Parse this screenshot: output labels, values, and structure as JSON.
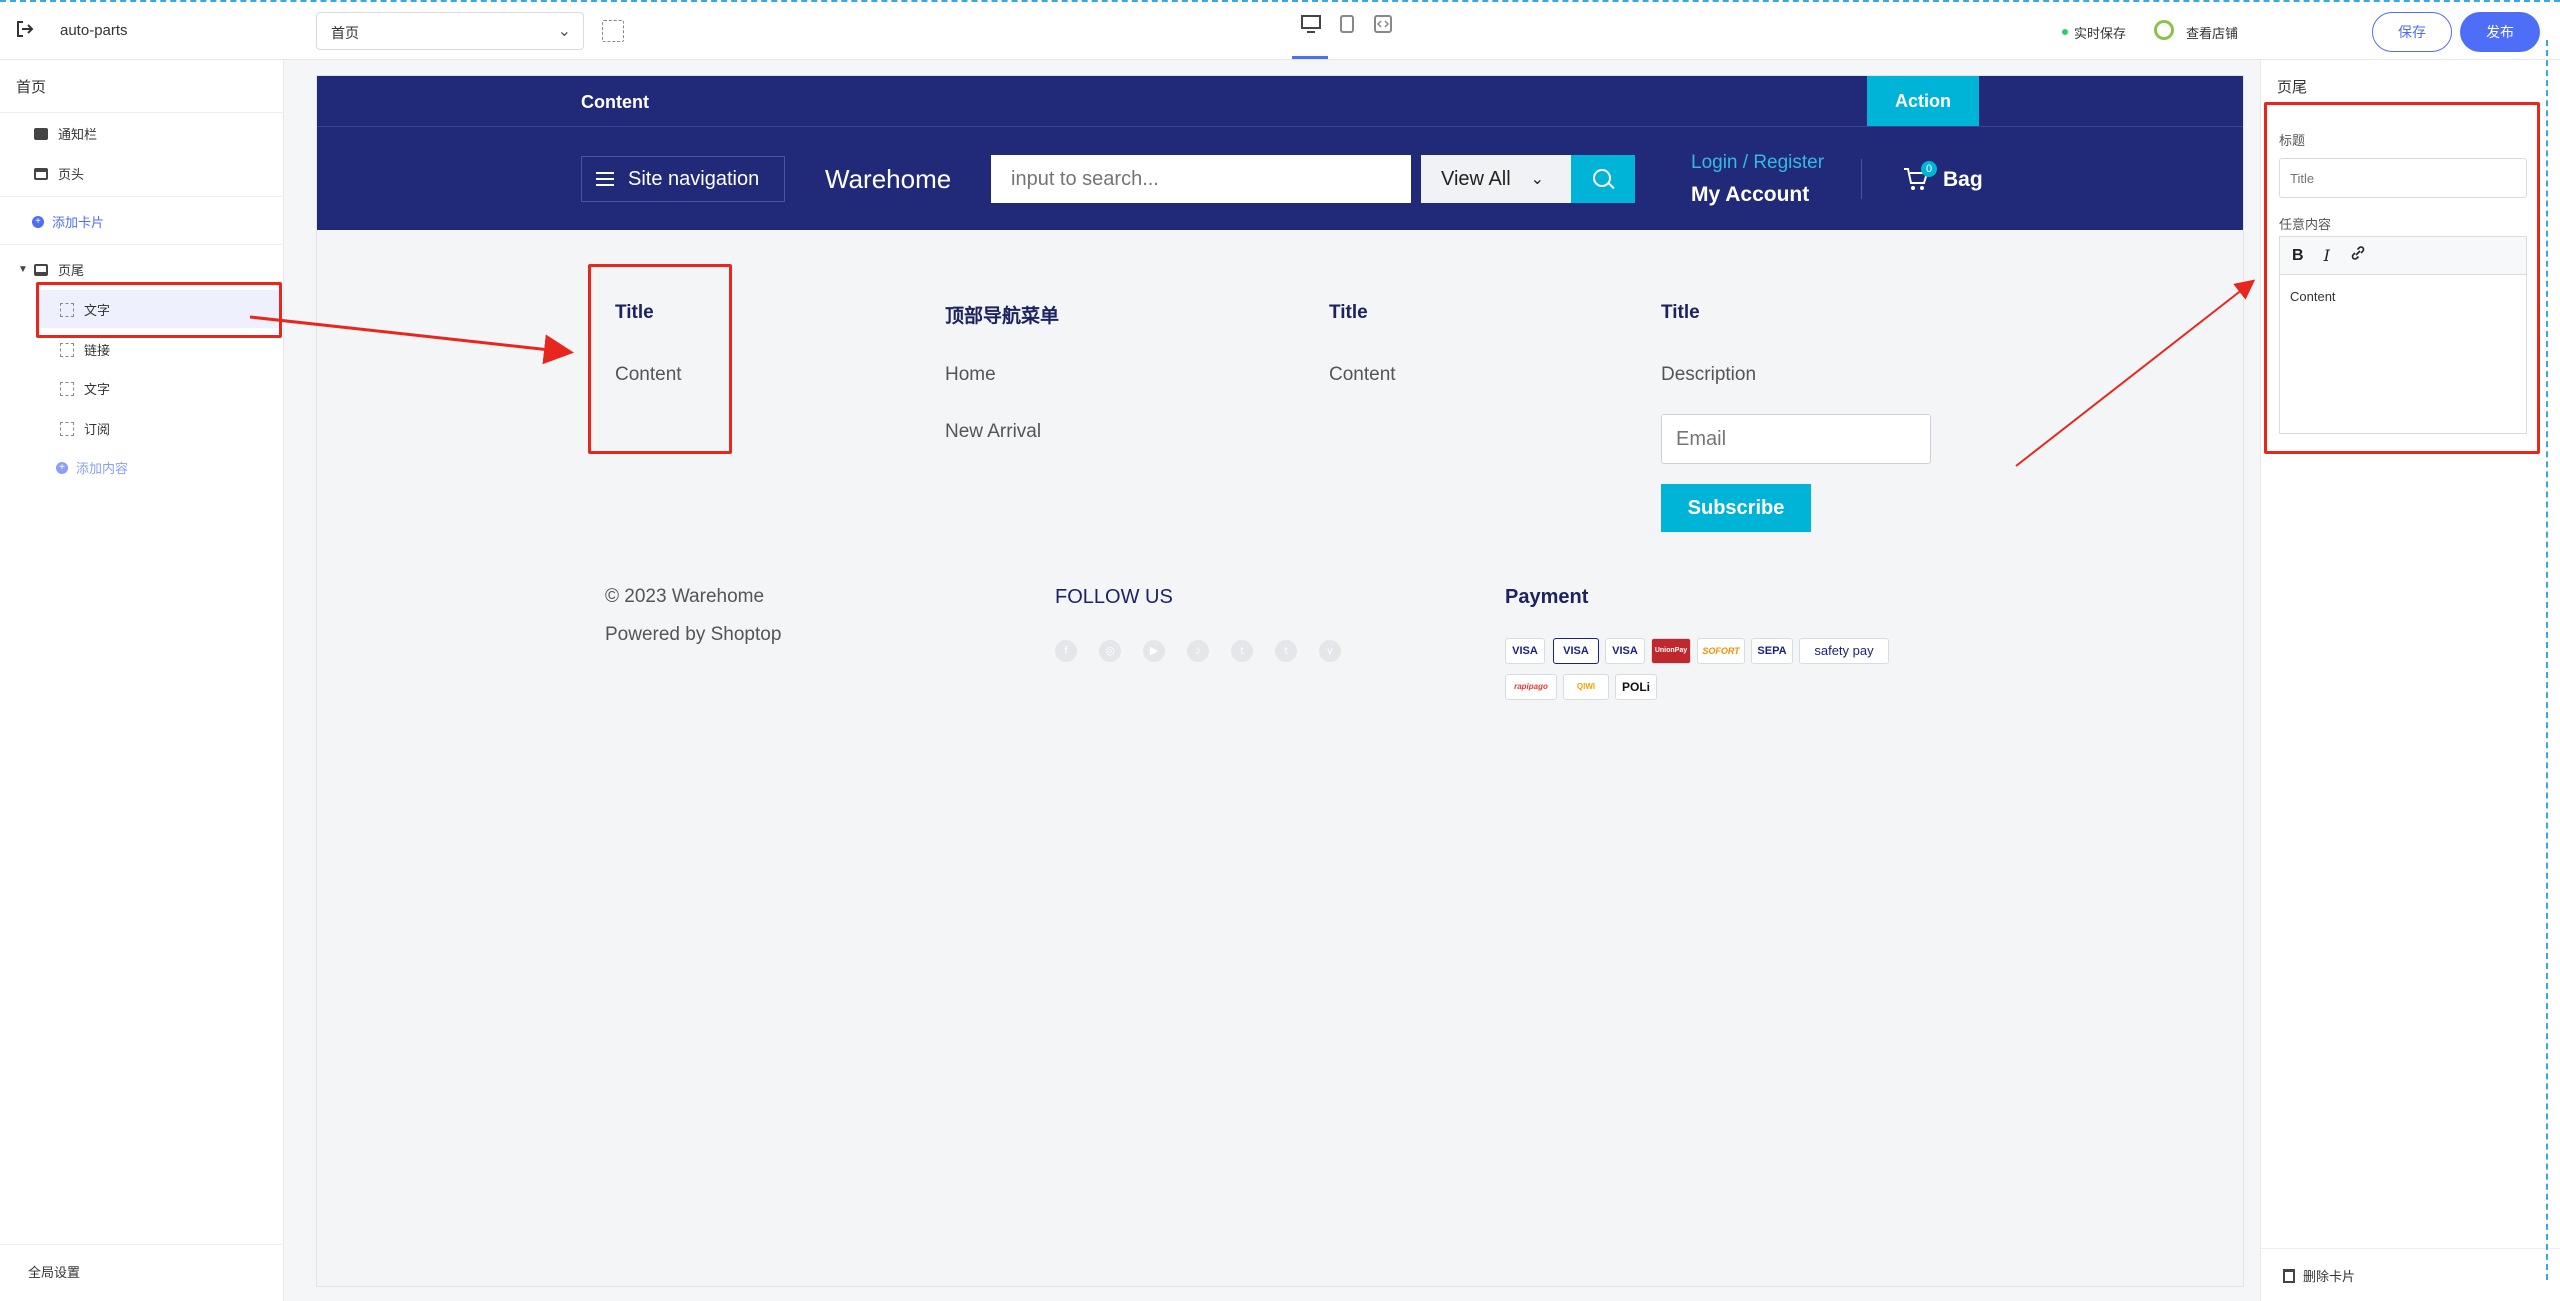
{
  "topbar": {
    "store_name": "auto-parts",
    "page_select": "首页",
    "autosave": "实时保存",
    "view_store": "查看店铺",
    "save": "保存",
    "publish": "发布"
  },
  "leftbar": {
    "title": "首页",
    "items": [
      {
        "label": "通知栏"
      },
      {
        "label": "页头"
      }
    ],
    "add_card": "添加卡片",
    "footer_group": "页尾",
    "footer_children": [
      {
        "label": "文字"
      },
      {
        "label": "链接"
      },
      {
        "label": "文字"
      },
      {
        "label": "订阅"
      }
    ],
    "add_content": "添加内容",
    "global_settings": "全局设置"
  },
  "preview": {
    "announcement": {
      "text": "Content",
      "action": "Action"
    },
    "header": {
      "site_nav": "Site navigation",
      "brand": "Warehome",
      "search_placeholder": "input to search...",
      "view_all": "View All",
      "login": "Login / Register",
      "account": "My Account",
      "cart_count": "0",
      "bag": "Bag"
    },
    "footer": {
      "col1": {
        "title": "Title",
        "content": "Content"
      },
      "col2": {
        "title": "顶部导航菜单",
        "links": [
          "Home",
          "New Arrival"
        ]
      },
      "col3": {
        "title": "Title",
        "content": "Content"
      },
      "col4": {
        "title": "Title",
        "description": "Description",
        "email_placeholder": "Email",
        "subscribe": "Subscribe"
      },
      "copyright": "© 2023 Warehome",
      "powered": "Powered by Shoptop",
      "follow_us": "FOLLOW US",
      "payment": "Payment",
      "payment_cards": [
        "VISA",
        "VISA",
        "VISA",
        "UnionPay",
        "SOFORT",
        "SEPA",
        "safety pay",
        "rapipago",
        "QIWI",
        "POLi"
      ]
    }
  },
  "rightbar": {
    "title": "页尾",
    "label_title": "标题",
    "title_placeholder": "Title",
    "label_content": "任意内容",
    "editor_bold": "B",
    "editor_italic": "I",
    "editor_content": "Content",
    "delete_card": "删除卡片"
  },
  "colors": {
    "navy": "#212a78",
    "cyan": "#00b4d8",
    "primary": "#4f6ef7",
    "annotation_red": "#e8261d"
  }
}
